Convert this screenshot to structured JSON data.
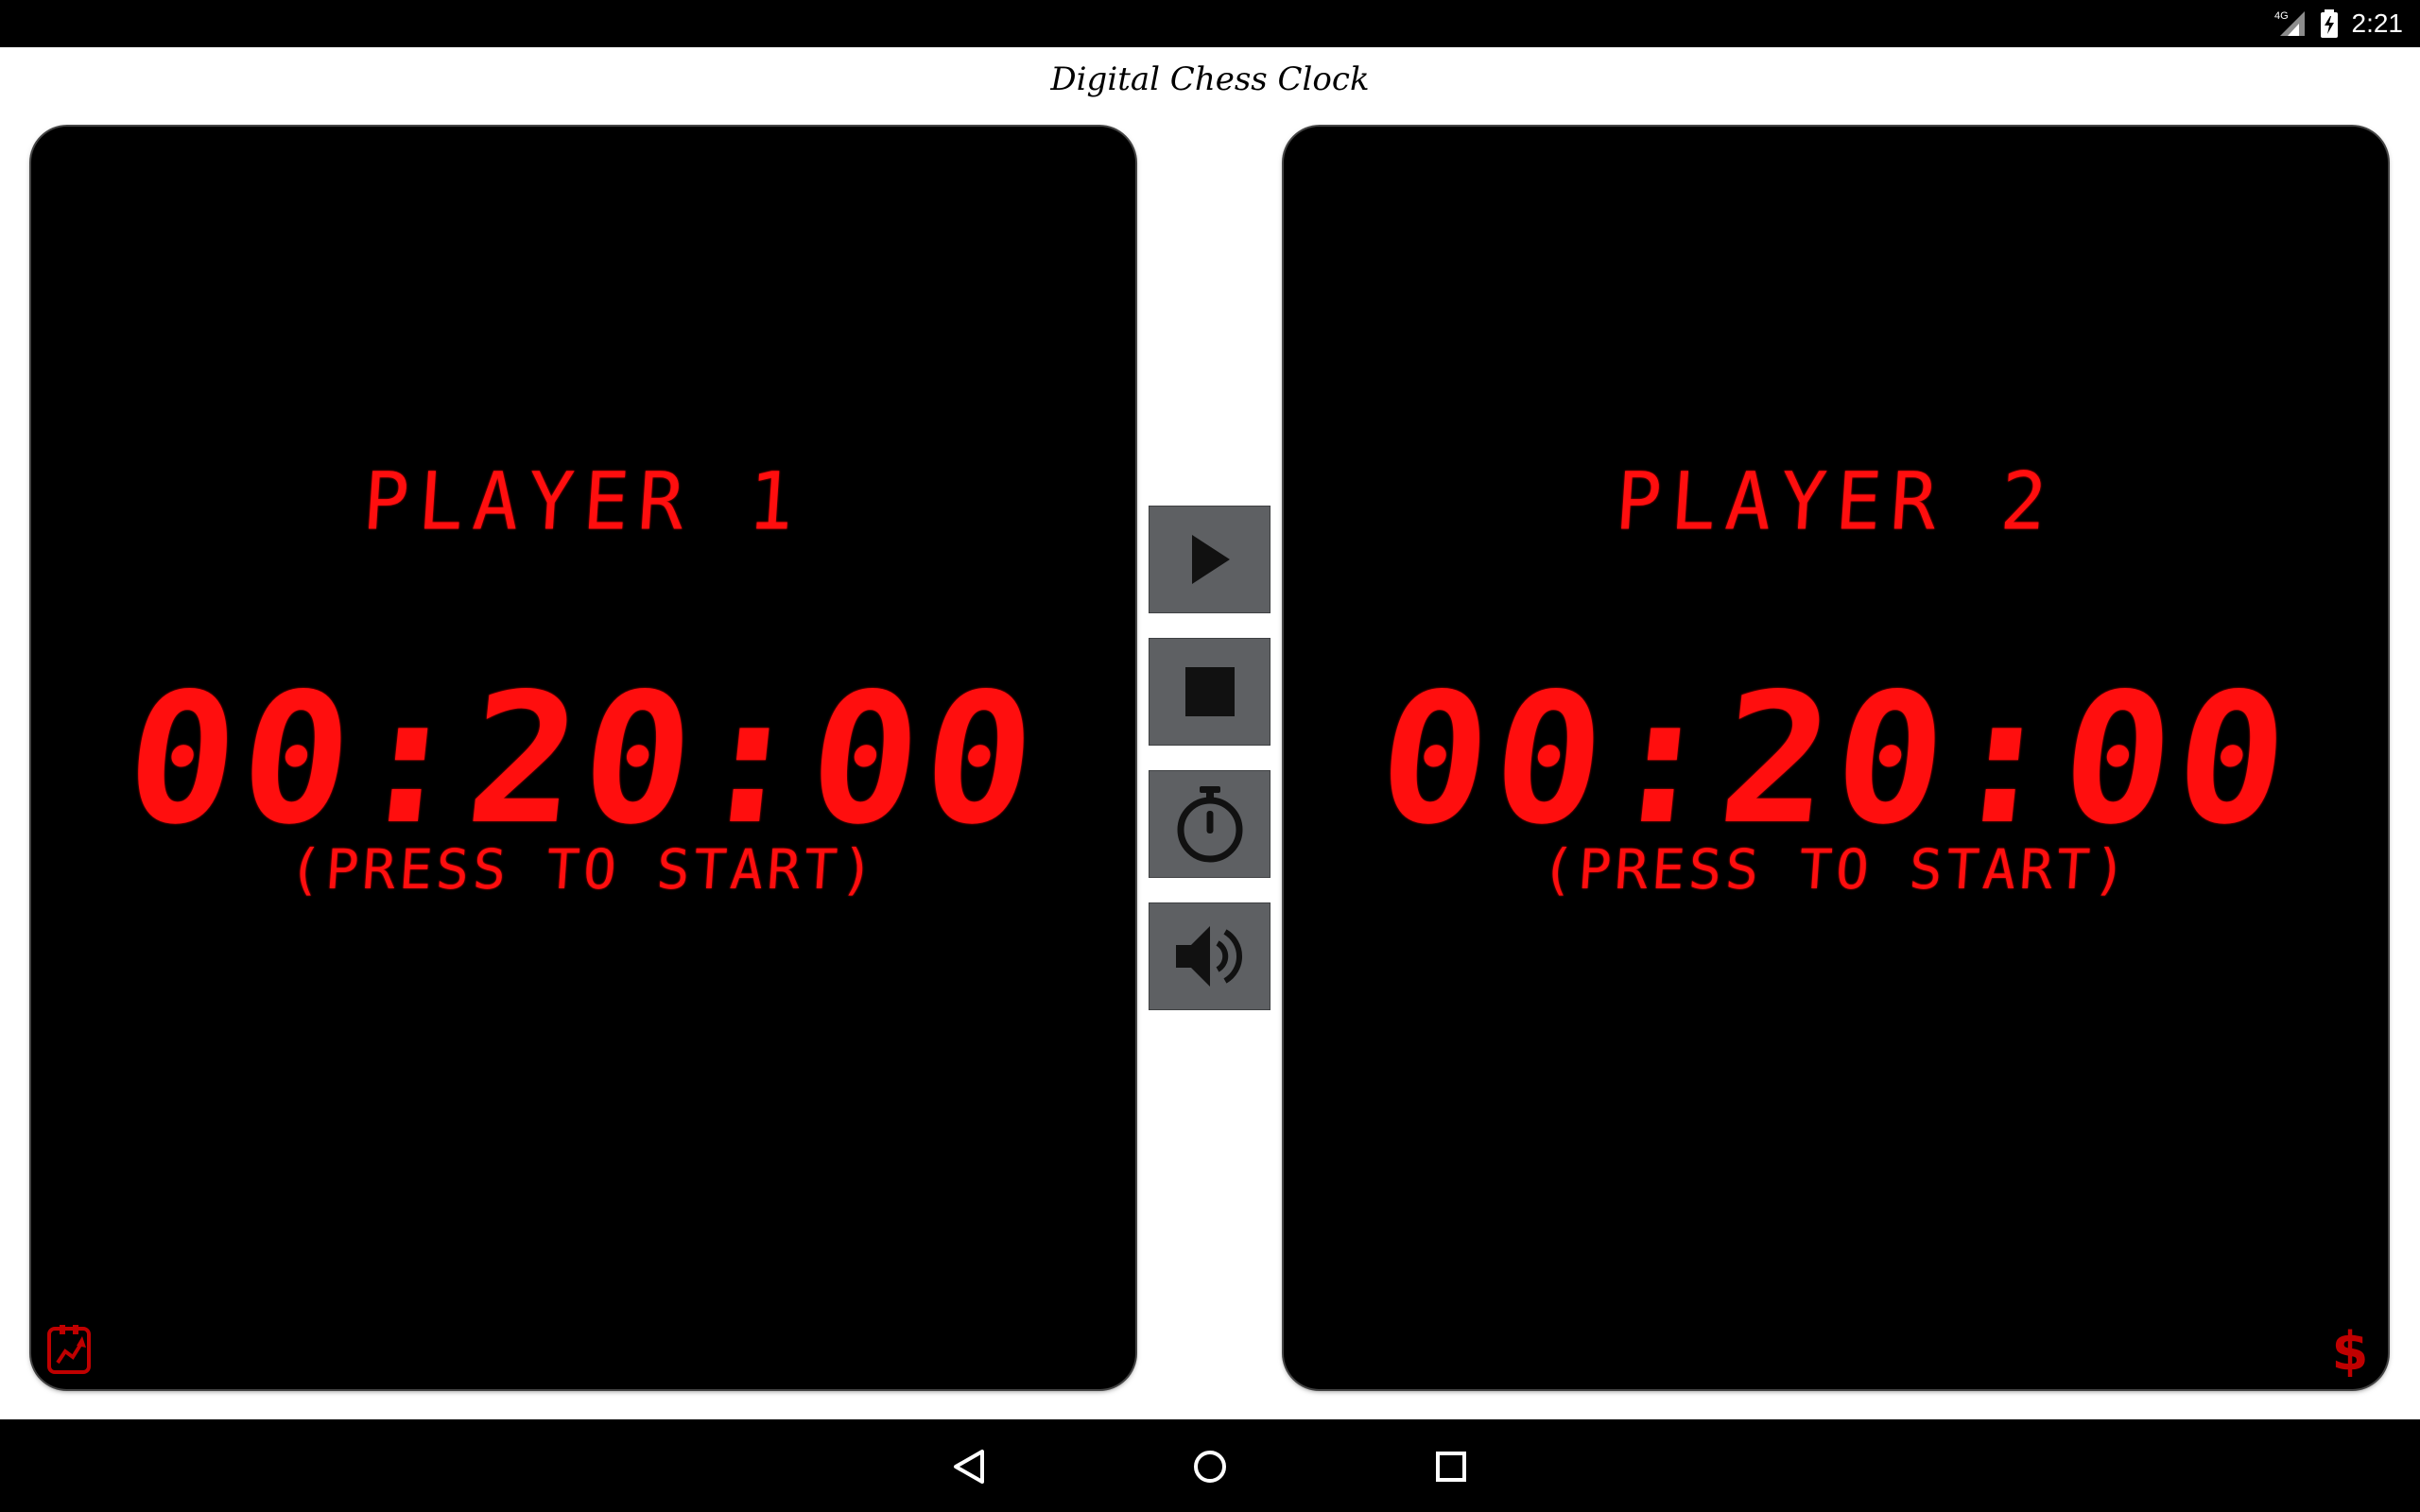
{
  "status_bar": {
    "time": "2:21",
    "network": "4G",
    "icons": [
      "signal-icon",
      "battery-charging-icon"
    ]
  },
  "app": {
    "title": "Digital Chess Clock"
  },
  "players": [
    {
      "name": "PLAYER 1",
      "time": "00:20:00",
      "hint": "(PRESS TO START)",
      "corner_icon": "rate-app-icon"
    },
    {
      "name": "PLAYER 2",
      "time": "00:20:00",
      "hint": "(PRESS TO START)",
      "corner_icon": "dollar-icon"
    }
  ],
  "controls": [
    {
      "name": "play-button",
      "icon": "play-icon"
    },
    {
      "name": "stop-button",
      "icon": "stop-icon"
    },
    {
      "name": "timer-settings-button",
      "icon": "stopwatch-icon"
    },
    {
      "name": "sound-toggle-button",
      "icon": "speaker-icon"
    }
  ],
  "nav_bar": {
    "buttons": [
      "back-icon",
      "home-icon",
      "recent-apps-icon"
    ]
  },
  "colors": {
    "lcd_red": "#ff0e0e",
    "panel_bg": "#000000",
    "button_bg": "#5e6063",
    "icon_dark": "#111111"
  }
}
